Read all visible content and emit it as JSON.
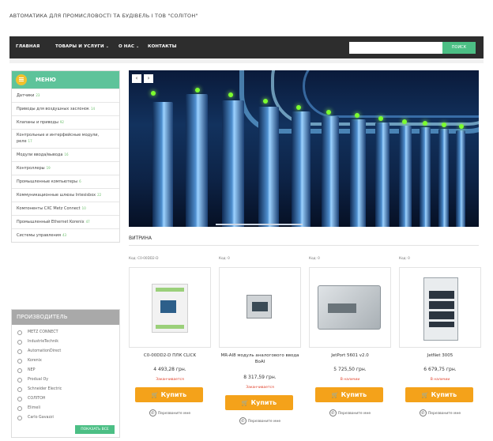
{
  "site": {
    "title": "АВТОМАТИКА ДЛЯ ПРОМИСЛОВОСТІ ТА БУДІВЕЛЬ І ТОВ \"СОЛІТОН\""
  },
  "nav": {
    "items": [
      {
        "label": "ГЛАВНАЯ",
        "has_dropdown": false
      },
      {
        "label": "ТОВАРЫ И УСЛУГИ",
        "has_dropdown": true
      },
      {
        "label": "О НАС",
        "has_dropdown": true
      },
      {
        "label": "КОНТАКТЫ",
        "has_dropdown": false
      }
    ],
    "search_placeholder": "",
    "search_button": "ПОИСК"
  },
  "menu": {
    "title": "МЕНЮ",
    "items": [
      {
        "label": "Датчики",
        "count": "23"
      },
      {
        "label": "Приводы для воздушных заслонок",
        "count": "14"
      },
      {
        "label": "Клапаны и приводы",
        "count": "92"
      },
      {
        "label": "Контрольные и интерфейсные модули, реле",
        "count": "17"
      },
      {
        "label": "Модули ввода/вывода",
        "count": "16"
      },
      {
        "label": "Контроллеры",
        "count": "19"
      },
      {
        "label": "Промышленные компьютеры",
        "count": "6"
      },
      {
        "label": "Коммуникационные шлюзы Intesisbox",
        "count": "22"
      },
      {
        "label": "Компоненты CXC Metz Connect",
        "count": "10"
      },
      {
        "label": "Промышленный Ethernet Korenix",
        "count": "47"
      },
      {
        "label": "Системы управления",
        "count": "43"
      }
    ]
  },
  "vendors": {
    "title": "ПРОИЗВОДИТЕЛЬ",
    "items": [
      "METZ CONNECT",
      "IndustrieTechnik",
      "AutomationDirect",
      "Korenix",
      "NEP",
      "Produal Oy",
      "Schneider Electric",
      "СОЛІТОН",
      "Elimeli",
      "Carlo Gavazzi"
    ],
    "show_all": "ПОКАЗАТЬ ВСЕ"
  },
  "slider": {
    "prev": "‹",
    "next": "›"
  },
  "showcase": {
    "title": "ВИТРИНА",
    "products": [
      {
        "code": "Код: C0-00DD2-D",
        "name": "C0-00DD2-D ПЛК CLICK",
        "price": "4 493,28 грн.",
        "stock": "Заканчивается",
        "buy": "Купить",
        "callback": "Перезвоните мне"
      },
      {
        "code": "Код: 0",
        "name": "MR-AI8 модуль аналогового ввода BoAI",
        "price": "8 317,59 грн.",
        "stock": "Заканчивается",
        "buy": "Купить",
        "callback": "Перезвоните мне"
      },
      {
        "code": "Код: 0",
        "name": "JetPort 5601 v2.0",
        "price": "5 725,50 грн.",
        "stock": "В наличии",
        "buy": "Купить",
        "callback": "Перезвоните мне"
      },
      {
        "code": "Код: 0",
        "name": "JetNet 3005",
        "price": "6 679,75 грн.",
        "stock": "В наличии",
        "buy": "Купить",
        "callback": "Перезвоните мне"
      }
    ]
  },
  "colors": {
    "nav_bg": "#2d2d2d",
    "accent_green": "#4cbf85",
    "menu_green": "#5ec39a",
    "buy_orange": "#f4a21a",
    "vendor_header": "#a9a9a9"
  }
}
